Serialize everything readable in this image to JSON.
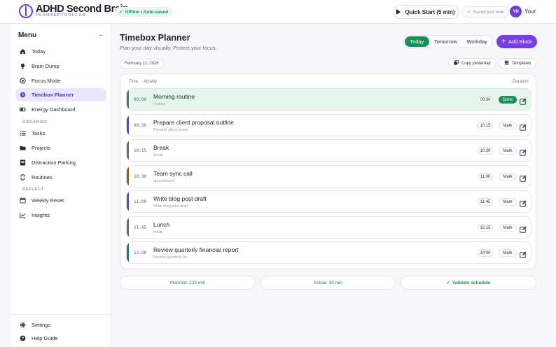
{
  "app": {
    "brand": "ADHD Second Brain",
    "brand_sub": "PLANNERTOOLLAB",
    "status": "Offline • Auto-saved",
    "quick_start": "Quick Start (5 min)",
    "saved": "Saved just now",
    "avatar_initials": "YN",
    "user_label": "Your"
  },
  "sidebar": {
    "title": "Menu",
    "items_main": [
      {
        "label": "Today",
        "icon": "home-icon"
      },
      {
        "label": "Brain Dump",
        "icon": "bulb-icon"
      },
      {
        "label": "Focus Mode",
        "icon": "target-icon"
      },
      {
        "label": "Timebox Planner",
        "icon": "clock-icon",
        "active": true
      },
      {
        "label": "Energy Dashboard",
        "icon": "battery-icon"
      }
    ],
    "section_organise": "ORGANISE",
    "items_organise": [
      {
        "label": "Tasks",
        "icon": "list-icon"
      },
      {
        "label": "Projects",
        "icon": "folder-icon"
      },
      {
        "label": "Distraction Parking",
        "icon": "parking-icon"
      },
      {
        "label": "Routines",
        "icon": "repeat-icon"
      }
    ],
    "section_reflect": "REFLECT",
    "items_reflect": [
      {
        "label": "Weekly Reset",
        "icon": "calendar-icon"
      },
      {
        "label": "Insights",
        "icon": "chart-icon"
      }
    ],
    "items_footer": [
      {
        "label": "Settings",
        "icon": "gear-icon"
      },
      {
        "label": "Help Guide",
        "icon": "help-icon"
      }
    ]
  },
  "main": {
    "title": "Timebox Planner",
    "subtitle": "Plan your day visually. Protect your focus.",
    "tabs": [
      "Today",
      "Tomorrow",
      "Workday"
    ],
    "active_tab": "Today",
    "add_block": "Add Block",
    "date": "February 11, 2026",
    "copy_yesterday": "Copy yesterday",
    "templates": "Templates",
    "columns": {
      "time": "Time",
      "activity": "Activity",
      "duration": "Duration"
    },
    "blocks": [
      {
        "start": "09:00",
        "end": "09:30",
        "title": "Morning routine",
        "type": "routine",
        "action": "Done",
        "done": true,
        "color": "#6a6a78"
      },
      {
        "start": "09:30",
        "end": "10:15",
        "title": "Prepare client proposal outline",
        "type": "Prepare client propo",
        "action": "Mark",
        "done": false,
        "color": "#6c3fd1"
      },
      {
        "start": "10:15",
        "end": "10:30",
        "title": "Break",
        "type": "break",
        "action": "Mark",
        "done": false,
        "color": "#6a6a78"
      },
      {
        "start": "10:30",
        "end": "11:00",
        "title": "Team sync call",
        "type": "appointment",
        "action": "Mark",
        "done": false,
        "color": "#9a5a1a"
      },
      {
        "start": "11:00",
        "end": "11:45",
        "title": "Write blog post draft",
        "type": "Write blog post draft",
        "action": "Mark",
        "done": false,
        "color": "#6c3fd1"
      },
      {
        "start": "11:45",
        "end": "12:15",
        "title": "Lunch",
        "type": "break",
        "action": "Mark",
        "done": false,
        "color": "#6a6a78"
      },
      {
        "start": "13:30",
        "end": "14:00",
        "title": "Review quarterly financial report",
        "type": "Review quarterly fin",
        "action": "Mark",
        "done": false,
        "color": "#1a7a8a"
      }
    ],
    "summary": {
      "planned": "Planned: 225 min",
      "actual": "Actual: 30 min",
      "validate": "Validate schedule"
    }
  }
}
